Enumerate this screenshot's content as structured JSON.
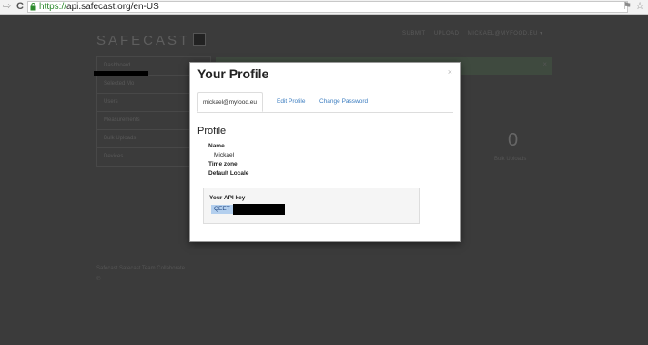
{
  "browser": {
    "url_proto": "https://",
    "url_rest": "api.safecast.org/en-US",
    "icons": [
      "back-arrow-icon",
      "reload-icon",
      "lock-icon",
      "extension-icon",
      "star-icon"
    ]
  },
  "site": {
    "logo_text": "SAFECAST",
    "topnav": [
      "SUBMIT",
      "UPLOAD",
      "MICKAEL@MYFOOD.EU ▾"
    ],
    "sidebar_items": [
      "Dashboard",
      "Selected Mo",
      "Users",
      "Measurements",
      "Bulk Uploads",
      "Devices"
    ],
    "stat_number": "0",
    "stat_label": "Bulk Uploads",
    "footer_line1": "Safecast Safecast Team Collaborate",
    "footer_line2": "©"
  },
  "modal": {
    "title": "Your Profile",
    "close": "×",
    "tabs": [
      "mickael@myfood.eu",
      "Edit Profile",
      "Change Password"
    ],
    "section_title": "Profile",
    "fields": {
      "name_label": "Name",
      "name_value": "Mickael",
      "timezone_label": "Time zone",
      "locale_label": "Default Locale"
    },
    "api": {
      "label": "Your API key",
      "key_visible": "QEET"
    }
  },
  "colors": {
    "overlay": "#3b3b3b",
    "link": "#3c7dc0",
    "selection": "#b3cfee",
    "secure_green": "#2d8a2d"
  }
}
